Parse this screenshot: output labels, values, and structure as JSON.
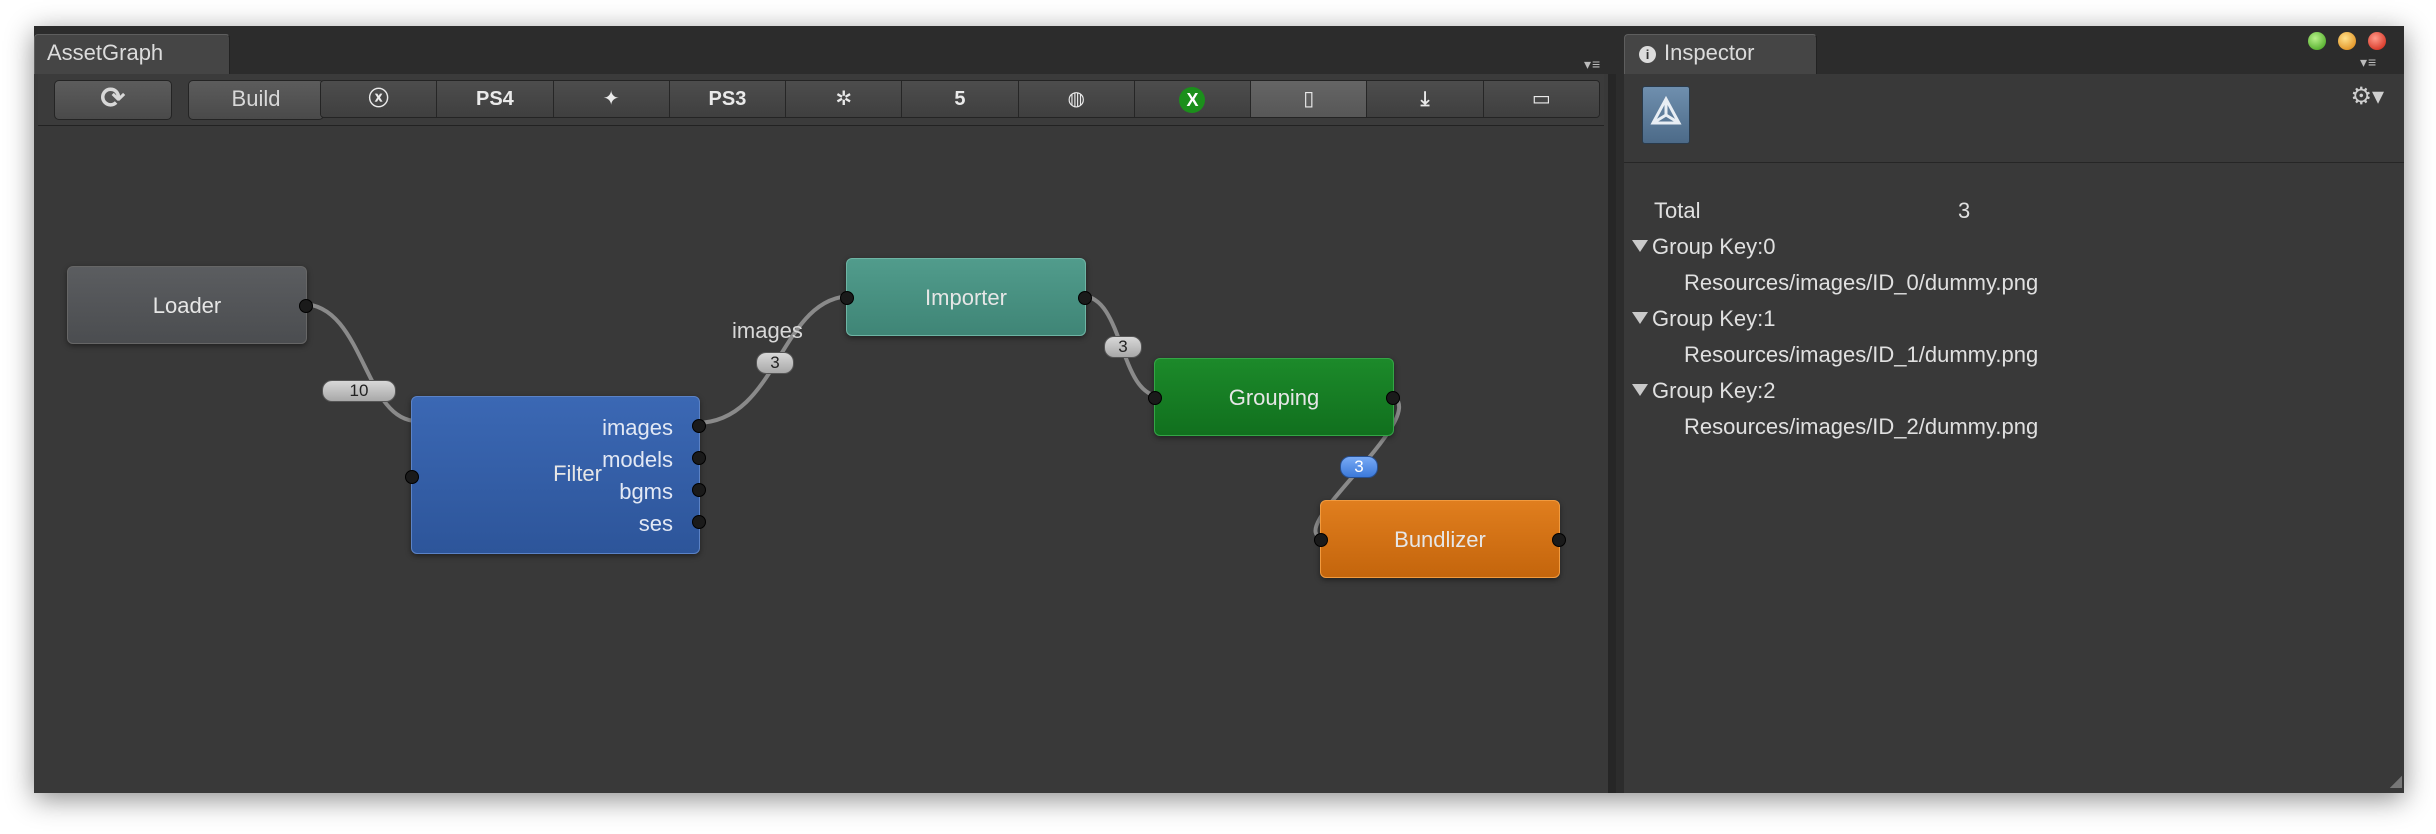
{
  "asset_graph": {
    "tab_title": "AssetGraph",
    "toolbar": {
      "refresh_icon": "refresh-icon",
      "build_label": "Build",
      "platforms": [
        {
          "name": "xbox360-icon",
          "glyph": "ⓧ",
          "active": false
        },
        {
          "name": "ps4-icon",
          "glyph": "PS4",
          "active": false
        },
        {
          "name": "android-icon",
          "glyph": "✦",
          "active": false
        },
        {
          "name": "ps3-icon",
          "glyph": "PS3",
          "active": false
        },
        {
          "name": "blackberry-icon",
          "glyph": "✲",
          "active": false
        },
        {
          "name": "html5-icon",
          "glyph": "5",
          "active": false
        },
        {
          "name": "webplayer-icon",
          "glyph": "◍",
          "active": false
        },
        {
          "name": "xboxone-icon",
          "glyph": "X",
          "active": false,
          "highlight": "#1b8f1b"
        },
        {
          "name": "mobile-icon",
          "glyph": "▯",
          "active": true
        },
        {
          "name": "download-icon",
          "glyph": "⤓",
          "active": false
        },
        {
          "name": "vita-icon",
          "glyph": "▭",
          "active": false
        }
      ]
    },
    "nodes": {
      "loader": {
        "title": "Loader",
        "color": "#505255"
      },
      "filter": {
        "title": "Filter",
        "color": "#3560a8",
        "outputs": [
          "images",
          "models",
          "bgms",
          "ses"
        ]
      },
      "importer": {
        "title": "Importer",
        "color": "#4a9282"
      },
      "grouping": {
        "title": "Grouping",
        "color": "#167d24"
      },
      "bundlizer": {
        "title": "Bundlizer",
        "color": "#d27116"
      }
    },
    "edges": {
      "loader_filter_count": "10",
      "filter_importer_label": "images",
      "filter_importer_count": "3",
      "importer_grouping_count": "3",
      "grouping_bundlizer_count": "3"
    }
  },
  "inspector": {
    "tab_title": "Inspector",
    "total_label": "Total",
    "total_value": "3",
    "groups": [
      {
        "key": "Group Key:0",
        "path": "Resources/images/ID_0/dummy.png"
      },
      {
        "key": "Group Key:1",
        "path": "Resources/images/ID_1/dummy.png"
      },
      {
        "key": "Group Key:2",
        "path": "Resources/images/ID_2/dummy.png"
      }
    ]
  }
}
